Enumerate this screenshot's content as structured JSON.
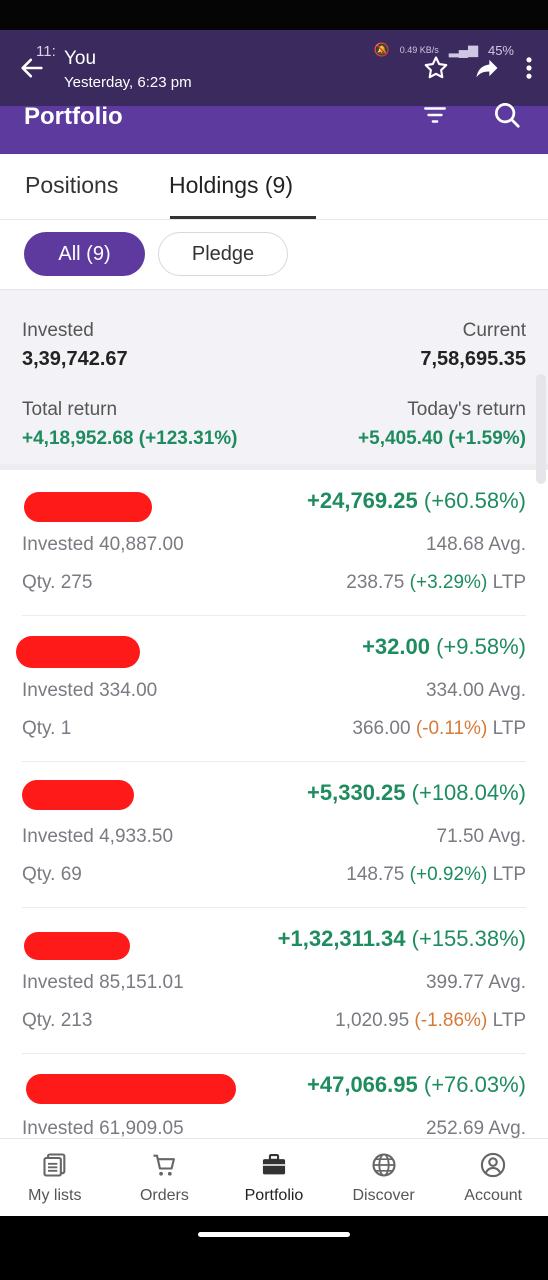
{
  "status": {
    "time": "11:",
    "battery": "45%",
    "net": "0.49 KB/s"
  },
  "overlay": {
    "sender": "You",
    "time": "Yesterday, 6:23 pm"
  },
  "app": {
    "title": "Portfolio"
  },
  "tabs": [
    {
      "label": "Positions",
      "active": false
    },
    {
      "label": "Holdings (9)",
      "active": true
    }
  ],
  "filters": [
    {
      "label": "All (9)",
      "active": true
    },
    {
      "label": "Pledge",
      "active": false
    }
  ],
  "summary": {
    "invested_label": "Invested",
    "invested_value": "3,39,742.67",
    "current_label": "Current",
    "current_value": "7,58,695.35",
    "total_return_label": "Total return",
    "total_return_value": "+4,18,952.68 (+123.31%)",
    "todays_return_label": "Today's return",
    "todays_return_value": "+5,405.40 (+1.59%)"
  },
  "holdings": [
    {
      "pnl": "+24,769.25",
      "pnl_pct": "(+60.58%)",
      "invested": "Invested 40,887.00",
      "avg": "148.68 Avg.",
      "qty": "Qty. 275",
      "ltp": "238.75",
      "ltp_chg": "(+3.29%)",
      "ltp_suffix": "LTP",
      "chg_positive": true
    },
    {
      "pnl": "+32.00",
      "pnl_pct": "(+9.58%)",
      "invested": "Invested 334.00",
      "avg": "334.00 Avg.",
      "qty": "Qty. 1",
      "ltp": "366.00",
      "ltp_chg": "(-0.11%)",
      "ltp_suffix": "LTP",
      "chg_positive": false
    },
    {
      "pnl": "+5,330.25",
      "pnl_pct": "(+108.04%)",
      "invested": "Invested 4,933.50",
      "avg": "71.50 Avg.",
      "qty": "Qty. 69",
      "ltp": "148.75",
      "ltp_chg": "(+0.92%)",
      "ltp_suffix": "LTP",
      "chg_positive": true
    },
    {
      "pnl": "+1,32,311.34",
      "pnl_pct": "(+155.38%)",
      "invested": "Invested 85,151.01",
      "avg": "399.77 Avg.",
      "qty": "Qty. 213",
      "ltp": "1,020.95",
      "ltp_chg": "(-1.86%)",
      "ltp_suffix": "LTP",
      "chg_positive": false
    },
    {
      "pnl": "+47,066.95",
      "pnl_pct": "(+76.03%)",
      "invested": "Invested 61,909.05",
      "avg": "252.69 Avg.",
      "qty": "",
      "ltp": "",
      "ltp_chg": "",
      "ltp_suffix": "",
      "chg_positive": true
    }
  ],
  "nav": [
    {
      "label": "My lists",
      "icon": "list-icon",
      "active": false
    },
    {
      "label": "Orders",
      "icon": "cart-icon",
      "active": false
    },
    {
      "label": "Portfolio",
      "icon": "briefcase-icon",
      "active": true
    },
    {
      "label": "Discover",
      "icon": "globe-icon",
      "active": false
    },
    {
      "label": "Account",
      "icon": "user-icon",
      "active": false
    }
  ],
  "colors": {
    "brand": "#5c3a9e",
    "gain": "#1e8c5e",
    "loss": "#d67a3a",
    "redaction": "#ff1a1a"
  }
}
